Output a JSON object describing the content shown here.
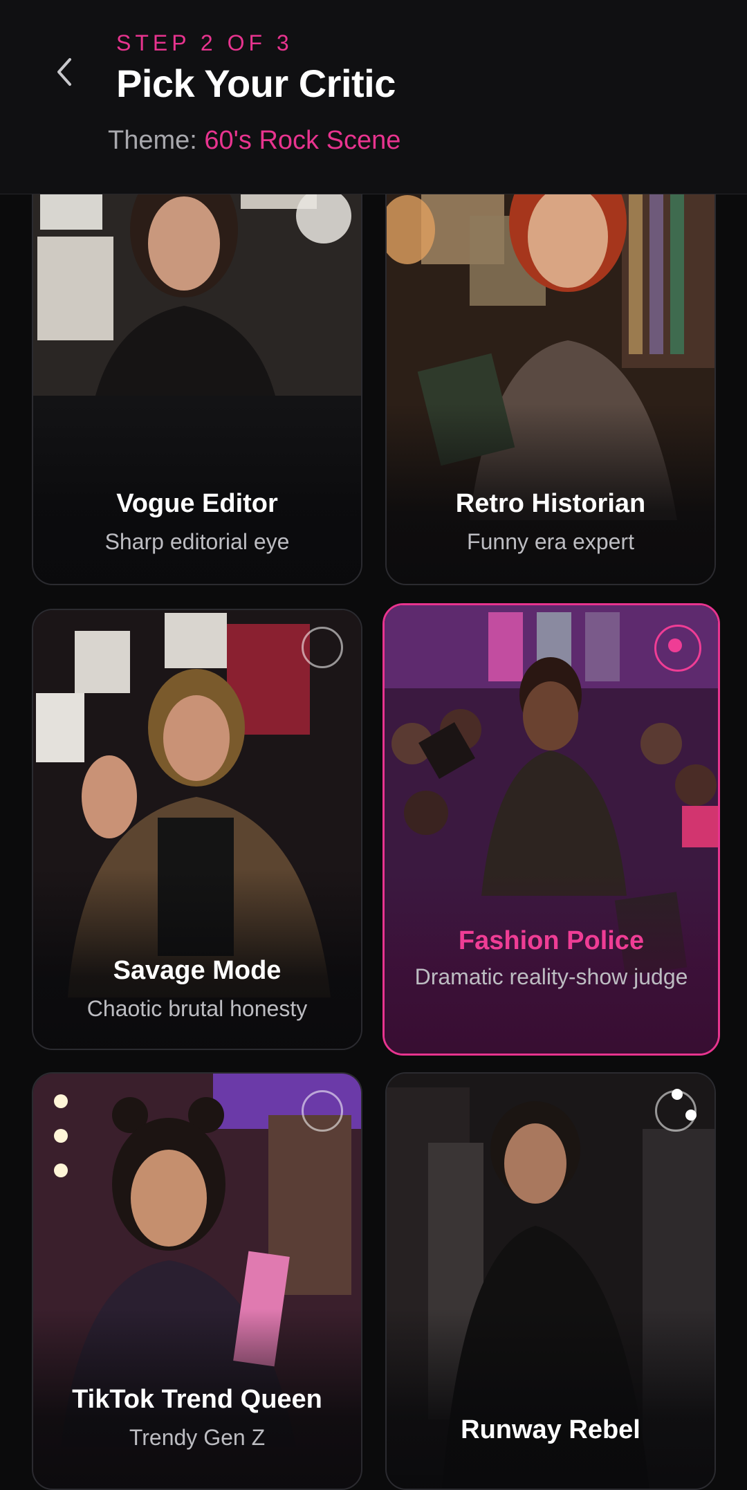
{
  "header": {
    "step": "STEP 2 OF 3",
    "title": "Pick Your Critic",
    "theme_label": "Theme:",
    "theme_value": "60's Rock Scene"
  },
  "critics": [
    {
      "name": "Vogue Editor",
      "description": "Sharp editorial eye",
      "selected": false
    },
    {
      "name": "Retro Historian",
      "description": "Funny era expert",
      "selected": false
    },
    {
      "name": "Savage Mode",
      "description": "Chaotic brutal honesty",
      "selected": false
    },
    {
      "name": "Fashion Police",
      "description": "Dramatic reality-show judge",
      "selected": true
    },
    {
      "name": "TikTok Trend Queen",
      "description": "Trendy Gen Z",
      "selected": false
    },
    {
      "name": "Runway Rebel",
      "description": "",
      "selected": false
    }
  ],
  "colors": {
    "accent": "#e8348f",
    "background": "#0b0b0c"
  }
}
